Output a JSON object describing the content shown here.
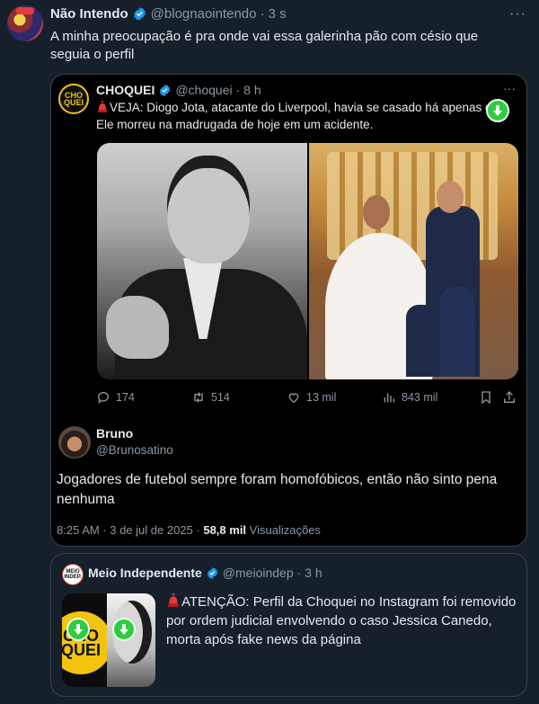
{
  "tweet": {
    "display_name": "Não Intendo",
    "handle": "@blognaointendo",
    "time": "· 3 s",
    "text": "A minha preocupação é pra onde vai essa galerinha pão com césio que seguia o perfil"
  },
  "quote": {
    "avatar_text": "CHO QUEI",
    "display_name": "CHOQUEI",
    "handle": "@choquei",
    "time": "· 8 h",
    "text": "VEJA: Diogo Jota, atacante do Liverpool, havia se casado há apenas dias. Ele morreu na madrugada de hoje em um acidente.",
    "stats": {
      "replies": "174",
      "retweets": "514",
      "likes": "13 mil",
      "views": "843 mil"
    },
    "reply": {
      "display_name": "Bruno",
      "handle": "@Brunosatino",
      "text": "Jogadores de futebol sempre foram homofóbicos, então não sinto pena nenhuma",
      "timestamp": "8:25 AM · 3 de jul de 2025 ·",
      "views_count": "58,8 mil",
      "views_label": "Visualizações"
    }
  },
  "quote2": {
    "avatar_text": "MEIO INDEP.",
    "display_name": "Meio Independente",
    "handle": "@meioindep",
    "time": "· 3 h",
    "text": "ATENÇÃO: Perfil da Choquei no Instagram foi removido por ordem judicial envolvendo o caso Jessica Canedo, morta após fake news da página",
    "thumb_logo_text": "CHO QUEI"
  },
  "colors": {
    "background": "#15202b",
    "verified": "#1d9bf0",
    "download_badge": "#2ecc40",
    "muted": "#8b98a5"
  },
  "icons": [
    "verified-badge-icon",
    "more-icon",
    "siren-icon",
    "download-arrow-icon",
    "reply-icon",
    "retweet-icon",
    "like-icon",
    "views-icon",
    "bookmark-icon",
    "share-icon"
  ]
}
